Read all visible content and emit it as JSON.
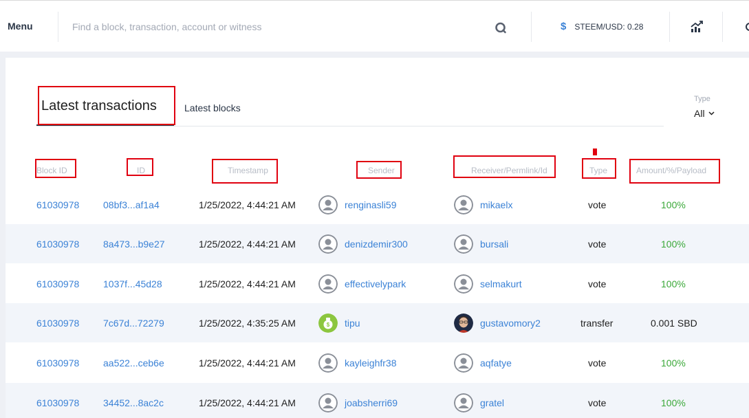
{
  "header": {
    "menu_label": "Menu",
    "search_placeholder": "Find a block, transaction, account or witness",
    "price_label": "STEEM/USD: 0.28",
    "price_symbol": "$"
  },
  "tabs": {
    "active": "Latest transactions",
    "other": "Latest blocks"
  },
  "filter": {
    "label": "Type",
    "value": "All"
  },
  "columns": [
    "Block ID",
    "ID",
    "Timestamp",
    "Sender",
    "Receiver/Permlink/Id",
    "Type",
    "Amount/%/Payload"
  ],
  "rows": [
    {
      "block": "61030978",
      "id": "08bf3...af1a4",
      "timestamp": "1/25/2022, 4:44:21 AM",
      "sender": "renginasli59",
      "receiver": "mikaelx",
      "type": "vote",
      "amount": "100%"
    },
    {
      "block": "61030978",
      "id": "8a473...b9e27",
      "timestamp": "1/25/2022, 4:44:21 AM",
      "sender": "denizdemir300",
      "receiver": "bursali",
      "type": "vote",
      "amount": "100%"
    },
    {
      "block": "61030978",
      "id": "1037f...45d28",
      "timestamp": "1/25/2022, 4:44:21 AM",
      "sender": "effectivelypark",
      "receiver": "selmakurt",
      "type": "vote",
      "amount": "100%"
    },
    {
      "block": "61030978",
      "id": "7c67d...72279",
      "timestamp": "1/25/2022, 4:35:25 AM",
      "sender": "tipu",
      "receiver": "gustavomory2",
      "type": "transfer",
      "amount": "0.001 SBD"
    },
    {
      "block": "61030978",
      "id": "aa522...ceb6e",
      "timestamp": "1/25/2022, 4:44:21 AM",
      "sender": "kayleighfr38",
      "receiver": "aqfatye",
      "type": "vote",
      "amount": "100%"
    },
    {
      "block": "61030978",
      "id": "34452...8ac2c",
      "timestamp": "1/25/2022, 4:44:21 AM",
      "sender": "joabsherri69",
      "receiver": "gratel",
      "type": "vote",
      "amount": "100%"
    }
  ],
  "colors": {
    "link": "#3b82d6",
    "positive": "#3aa838",
    "annotation": "#e0000f",
    "row_alt": "#f2f5fa"
  }
}
